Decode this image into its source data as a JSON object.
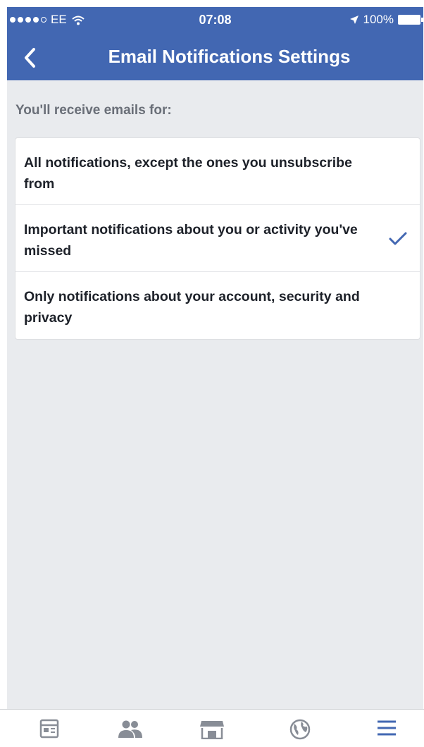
{
  "status_bar": {
    "carrier": "EE",
    "time": "07:08",
    "battery": "100%"
  },
  "header": {
    "title": "Email Notifications Settings"
  },
  "section": {
    "label": "You'll receive emails for:"
  },
  "options": [
    {
      "text": "All notifications, except the ones you unsubscribe from",
      "selected": false
    },
    {
      "text": "Important notifications about you or activity you've missed",
      "selected": true
    },
    {
      "text": "Only notifications about your account, security and privacy",
      "selected": false
    }
  ],
  "tab_bar": {
    "tabs": [
      {
        "icon": "news-feed-icon",
        "active": false
      },
      {
        "icon": "friends-icon",
        "active": false
      },
      {
        "icon": "marketplace-icon",
        "active": false
      },
      {
        "icon": "globe-icon",
        "active": false
      },
      {
        "icon": "menu-icon",
        "active": true
      }
    ]
  },
  "colors": {
    "header_bg": "#4267b2",
    "page_bg": "#e9ebee",
    "check": "#4267b2",
    "tab_icon": "#888d96",
    "tab_active": "#4267b2"
  }
}
